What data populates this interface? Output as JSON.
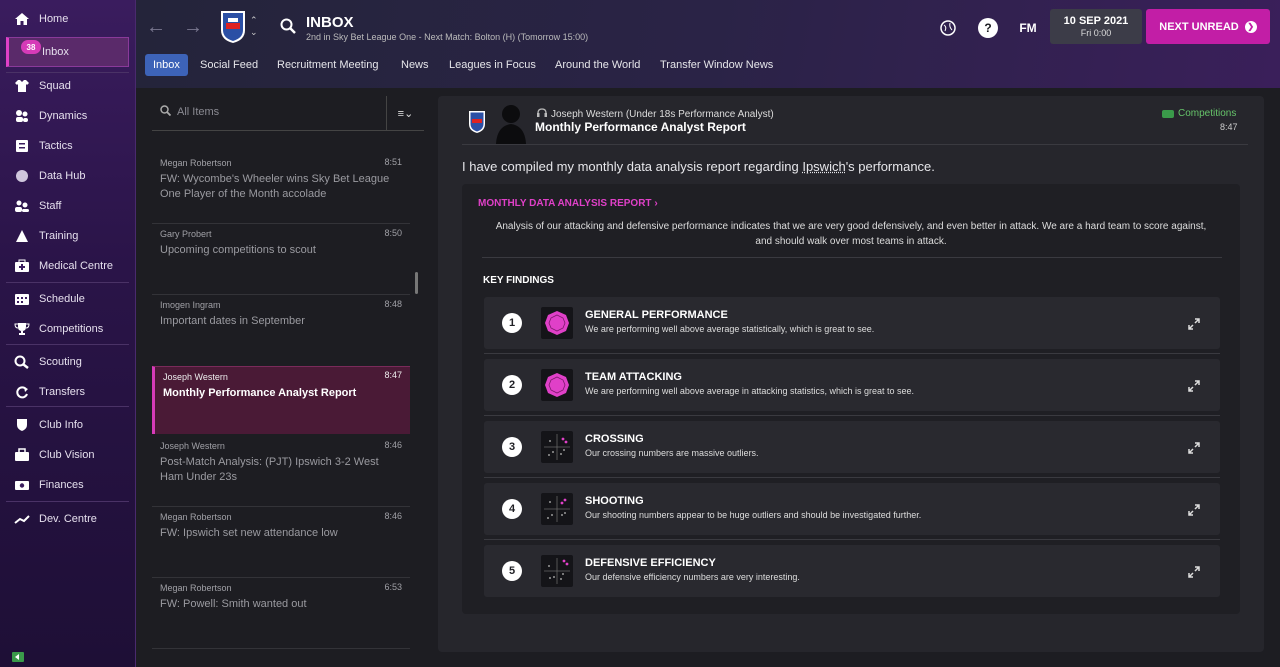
{
  "sidebar": {
    "items": [
      {
        "label": "Home",
        "icon": "home-icon"
      },
      {
        "label": "Inbox",
        "icon": "inbox-icon",
        "badge": "38"
      },
      {
        "label": "Squad",
        "icon": "shirt-icon"
      },
      {
        "label": "Dynamics",
        "icon": "dynamics-icon"
      },
      {
        "label": "Tactics",
        "icon": "tactics-icon"
      },
      {
        "label": "Data Hub",
        "icon": "data-hub-icon"
      },
      {
        "label": "Staff",
        "icon": "staff-icon"
      },
      {
        "label": "Training",
        "icon": "training-icon"
      },
      {
        "label": "Medical Centre",
        "icon": "medical-icon"
      },
      {
        "label": "Schedule",
        "icon": "calendar-icon"
      },
      {
        "label": "Competitions",
        "icon": "trophy-icon"
      },
      {
        "label": "Scouting",
        "icon": "search-icon"
      },
      {
        "label": "Transfers",
        "icon": "transfers-icon"
      },
      {
        "label": "Club Info",
        "icon": "shield-icon"
      },
      {
        "label": "Club Vision",
        "icon": "briefcase-icon"
      },
      {
        "label": "Finances",
        "icon": "money-icon"
      },
      {
        "label": "Dev. Centre",
        "icon": "dev-centre-icon"
      }
    ]
  },
  "header": {
    "title": "INBOX",
    "subtitle": "2nd in Sky Bet League One - Next Match: Bolton (H) (Tomorrow 15:00)",
    "fm_label": "FM",
    "help_label": "?",
    "date": "10 SEP 2021",
    "day_time": "Fri 0:00",
    "next_unread": "NEXT UNREAD"
  },
  "tabs": [
    "Inbox",
    "Social Feed",
    "Recruitment Meeting",
    "News",
    "Leagues in Focus",
    "Around the World",
    "Transfer Window News"
  ],
  "list": {
    "search_placeholder": "All Items",
    "messages": [
      {
        "from": "Megan Robertson",
        "time": "8:51",
        "subject": "FW: Wycombe's Wheeler wins Sky Bet League One Player of the Month accolade"
      },
      {
        "from": "Gary Probert",
        "time": "8:50",
        "subject": "Upcoming competitions to scout"
      },
      {
        "from": "Imogen Ingram",
        "time": "8:48",
        "subject": "Important dates in September"
      },
      {
        "from": "Joseph Western",
        "time": "8:47",
        "subject": "Monthly Performance Analyst Report"
      },
      {
        "from": "Joseph Western",
        "time": "8:46",
        "subject": "Post-Match Analysis: (PJT) Ipswich 3-2 West Ham Under 23s"
      },
      {
        "from": "Megan Robertson",
        "time": "8:46",
        "subject": "FW: Ipswich set new attendance low"
      },
      {
        "from": "Megan Robertson",
        "time": "6:53",
        "subject": "FW: Powell: Smith wanted out"
      }
    ]
  },
  "reader": {
    "from": "Joseph Western (Under 18s Performance Analyst)",
    "subject": "Monthly Performance Analyst Report",
    "tag": "Competitions",
    "time": "8:47",
    "intro_pre": "I have compiled my monthly data analysis report regarding ",
    "intro_club": "Ipswich",
    "intro_post": "'s performance.",
    "report_title": "MONTHLY DATA ANALYSIS REPORT",
    "report_desc": "Analysis of our attacking and defensive performance indicates that we are very good defensively, and even better in attack. We are a hard team to score against, and should walk over most teams in attack.",
    "key_findings_title": "KEY FINDINGS",
    "findings": [
      {
        "num": "1",
        "title": "GENERAL PERFORMANCE",
        "desc": "We are performing well above average statistically, which is great to see."
      },
      {
        "num": "2",
        "title": "TEAM ATTACKING",
        "desc": "We are performing well above average in attacking statistics, which is great to see."
      },
      {
        "num": "3",
        "title": "CROSSING",
        "desc": "Our crossing numbers are massive outliers."
      },
      {
        "num": "4",
        "title": "SHOOTING",
        "desc": "Our shooting numbers appear to be huge outliers and should be investigated further."
      },
      {
        "num": "5",
        "title": "DEFENSIVE EFFICIENCY",
        "desc": "Our defensive efficiency numbers are very interesting."
      }
    ]
  },
  "colors": {
    "accent": "#c21ea6",
    "tab_active": "#3d63b8",
    "tag_green": "#66c46a"
  }
}
